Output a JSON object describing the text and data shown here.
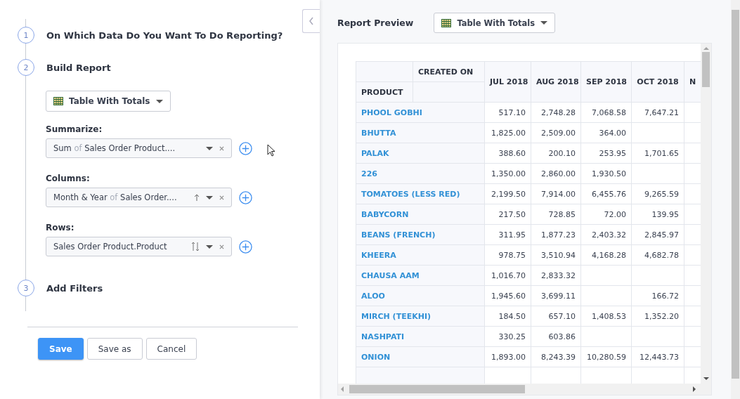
{
  "steps": [
    {
      "number": "1",
      "title": "On Which Data Do You Want To Do Reporting?"
    },
    {
      "number": "2",
      "title": "Build Report"
    },
    {
      "number": "3",
      "title": "Add Filters"
    }
  ],
  "build": {
    "view_select": "Table With Totals",
    "sections": [
      {
        "label": "Summarize:",
        "parts": [
          {
            "text": "Sum",
            "kind": "main"
          },
          {
            "text": "of",
            "kind": "muted"
          },
          {
            "text": "Sales Order Product....",
            "kind": "main"
          }
        ],
        "kind": "plain"
      },
      {
        "label": "Columns:",
        "parts": [
          {
            "text": "Month & Year",
            "kind": "main"
          },
          {
            "text": "of",
            "kind": "muted"
          },
          {
            "text": "Sales Order....",
            "kind": "main"
          }
        ],
        "kind": "sort-up"
      },
      {
        "label": "Rows:",
        "parts": [
          {
            "text": "Sales Order Product.Product",
            "kind": "main"
          }
        ],
        "kind": "sort-both"
      }
    ]
  },
  "buttons": [
    {
      "label": "Save",
      "kind": "primary"
    },
    {
      "label": "Save as",
      "kind": "default"
    },
    {
      "label": "Cancel",
      "kind": "default"
    }
  ],
  "preview": {
    "title": "Report Preview",
    "view_select": "Table With Totals",
    "table": {
      "corner_top": "CREATED ON",
      "corner_bottom": "PRODUCT",
      "columns": [
        "JUL 2018",
        "AUG 2018",
        "SEP 2018",
        "OCT 2018",
        "N"
      ],
      "rows": [
        {
          "product": "PHOOL GOBHI",
          "jul": "517.10",
          "aug": "2,748.28",
          "sep": "7,068.58",
          "oct": "7,647.21"
        },
        {
          "product": "BHUTTA",
          "jul": "1,825.00",
          "aug": "2,509.00",
          "sep": "364.00"
        },
        {
          "product": "PALAK",
          "jul": "388.60",
          "aug": "200.10",
          "sep": "253.95",
          "oct": "1,701.65"
        },
        {
          "product": "226",
          "jul": "1,350.00",
          "aug": "2,860.00",
          "sep": "1,930.50"
        },
        {
          "product": "TOMATOES (LESS RED)",
          "jul": "2,199.50",
          "aug": "7,914.00",
          "sep": "6,455.76",
          "oct": "9,265.59"
        },
        {
          "product": "BABYCORN",
          "jul": "217.50",
          "aug": "728.85",
          "sep": "72.00",
          "oct": "139.95"
        },
        {
          "product": "BEANS (FRENCH)",
          "jul": "311.95",
          "aug": "1,877.23",
          "sep": "2,403.32",
          "oct": "2,845.97"
        },
        {
          "product": "KHEERA",
          "jul": "978.75",
          "aug": "3,510.94",
          "sep": "4,168.28",
          "oct": "4,682.78"
        },
        {
          "product": "CHAUSA AAM",
          "jul": "1,016.70",
          "aug": "2,833.32"
        },
        {
          "product": "ALOO",
          "jul": "1,945.60",
          "aug": "3,699.11",
          "oct": "166.72"
        },
        {
          "product": "MIRCH (TEEKHI)",
          "jul": "184.50",
          "aug": "657.10",
          "sep": "1,408.53",
          "oct": "1,352.20"
        },
        {
          "product": "NASHPATI",
          "jul": "330.25",
          "aug": "603.86"
        },
        {
          "product": "ONION",
          "jul": "1,893.00",
          "aug": "8,243.39",
          "sep": "10,280.59",
          "oct": "12,443.73"
        }
      ]
    }
  }
}
